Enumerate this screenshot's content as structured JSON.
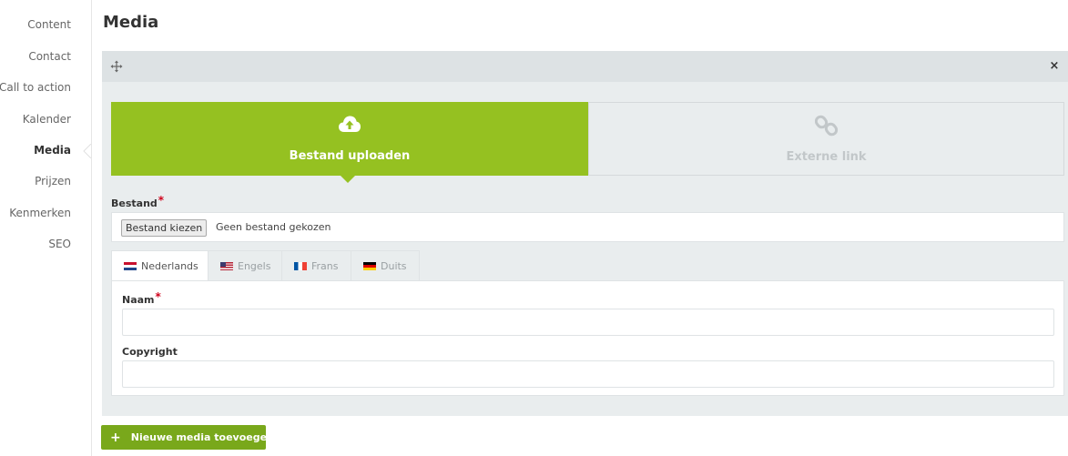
{
  "sidebar": {
    "items": [
      {
        "label": "Content"
      },
      {
        "label": "Contact"
      },
      {
        "label": "Call to action"
      },
      {
        "label": "Kalender"
      },
      {
        "label": "Media"
      },
      {
        "label": "Prijzen"
      },
      {
        "label": "Kenmerken"
      },
      {
        "label": "SEO"
      }
    ],
    "active": "Media"
  },
  "page": {
    "title": "Media"
  },
  "panel": {
    "move_icon": "move-icon",
    "close_icon": "close-icon",
    "close_glyph": "×",
    "source_toggle": {
      "upload": {
        "label": "Bestand uploaden",
        "icon": "cloud-upload-icon",
        "selected": true
      },
      "link": {
        "label": "Externe link",
        "icon": "chain-link-icon",
        "selected": false
      }
    },
    "file_field": {
      "label": "Bestand",
      "required": "*",
      "button_label": "Bestand kiezen",
      "status": "Geen bestand gekozen"
    },
    "language_tabs": [
      {
        "label": "Nederlands",
        "flag": "nl",
        "active": true
      },
      {
        "label": "Engels",
        "flag": "us",
        "active": false
      },
      {
        "label": "Frans",
        "flag": "fr",
        "active": false
      },
      {
        "label": "Duits",
        "flag": "de",
        "active": false
      }
    ],
    "name_field": {
      "label": "Naam",
      "required": "*",
      "value": ""
    },
    "copyright_field": {
      "label": "Copyright",
      "value": ""
    }
  },
  "add_button": {
    "label": "Nieuwe media toevoegen",
    "glyph": "+"
  },
  "colors": {
    "accent": "#95c121",
    "button": "#79a81b",
    "panel_bg": "#e9edee",
    "panel_header": "#dde2e4",
    "required": "#d0021b"
  }
}
